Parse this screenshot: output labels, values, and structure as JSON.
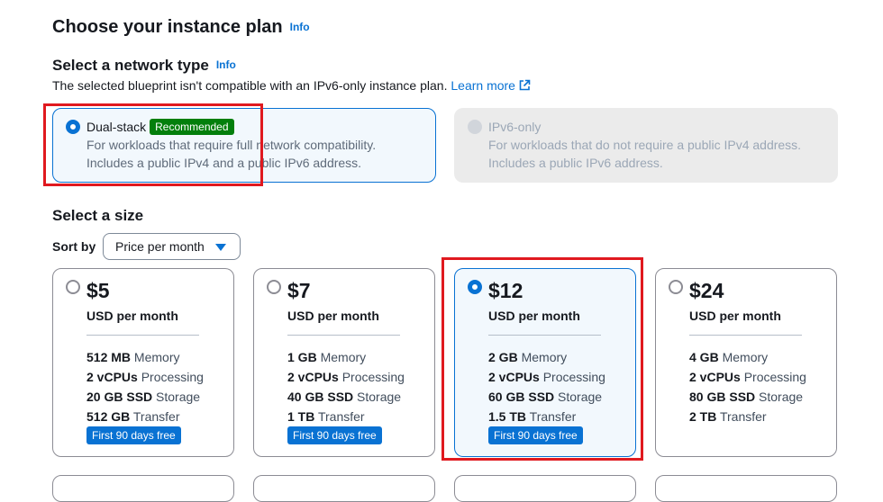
{
  "header": {
    "title": "Choose your instance plan",
    "info": "Info"
  },
  "network": {
    "title": "Select a network type",
    "info": "Info",
    "note": "The selected blueprint isn't compatible with an IPv6-only instance plan.",
    "learn_more": "Learn more",
    "options": [
      {
        "label": "Dual-stack",
        "badge": "Recommended",
        "desc_line1": "For workloads that require full network compatibility.",
        "desc_line2": "Includes a public IPv4 and a public IPv6 address.",
        "selected": true
      },
      {
        "label": "IPv6-only",
        "desc_line1": "For workloads that do not require a public IPv4 address.",
        "desc_line2": "Includes a public IPv6 address.",
        "disabled": true
      }
    ]
  },
  "size": {
    "title": "Select a size",
    "sort_label": "Sort by",
    "sort_value": "Price per month",
    "per_month": "USD per month",
    "labels": {
      "memory": "Memory",
      "processing": "Processing",
      "storage": "Storage",
      "transfer": "Transfer"
    },
    "plans": [
      {
        "price": "$5",
        "memory": "512 MB",
        "cpus": "2 vCPUs",
        "storage": "20 GB SSD",
        "transfer": "512 GB",
        "badge": "First 90 days free",
        "selected": false
      },
      {
        "price": "$7",
        "memory": "1 GB",
        "cpus": "2 vCPUs",
        "storage": "40 GB SSD",
        "transfer": "1 TB",
        "badge": "First 90 days free",
        "selected": false
      },
      {
        "price": "$12",
        "memory": "2 GB",
        "cpus": "2 vCPUs",
        "storage": "60 GB SSD",
        "transfer": "1.5 TB",
        "badge": "First 90 days free",
        "selected": true
      },
      {
        "price": "$24",
        "memory": "4 GB",
        "cpus": "2 vCPUs",
        "storage": "80 GB SSD",
        "transfer": "2 TB",
        "selected": false
      }
    ]
  },
  "colors": {
    "accent": "#0972d3",
    "recommended": "#037f0c",
    "highlight": "#e0191f"
  }
}
